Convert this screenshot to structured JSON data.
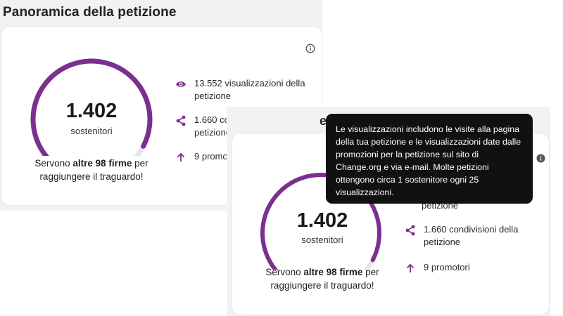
{
  "page": {
    "title": "Panoramica della petizione",
    "accent_color": "#7b2f8f",
    "track_color": "#e6e6e6"
  },
  "overview": {
    "supporters_count": "1.402",
    "supporters_label": "sostenitori",
    "progress_fraction": 0.935,
    "goal_prefix": "Servono ",
    "goal_highlight": "altre 98 firme",
    "goal_suffix": " per",
    "goal_line2": "raggiungere il traguardo!",
    "stats": [
      {
        "icon": "eye-icon",
        "line1": "13.552 visualizzazioni della",
        "line2": "petizione"
      },
      {
        "icon": "share-icon",
        "line1": "1.660 condivisioni della",
        "line2": "petizione"
      },
      {
        "icon": "arrow-up-icon",
        "line1": "9 promotori",
        "line2": ""
      }
    ],
    "info_icon": "info-icon"
  },
  "second_view": {
    "partial_title": "e",
    "partial_stat_line2": "petizione"
  },
  "tooltip": {
    "text": "Le visualizzazioni includono le visite alla pagina della tua petizione e le visualizzazioni date dalle promozioni per la petizione sul sito di Change.org e via e-mail. Molte petizioni ottengono circa 1 sostenitore ogni 25 visualizzazioni."
  }
}
